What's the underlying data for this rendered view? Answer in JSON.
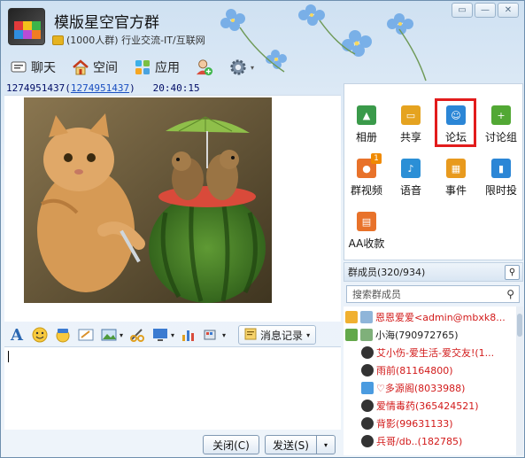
{
  "window": {
    "group_name": "模版星空官方群",
    "member_info": "(1000人群) 行业交流-IT/互联网",
    "controls": [
      "minimize",
      "maximize",
      "close"
    ]
  },
  "toolbar": {
    "items": [
      {
        "label": "聊天",
        "icon": "chat-icon"
      },
      {
        "label": "空间",
        "icon": "home-icon"
      },
      {
        "label": "应用",
        "icon": "apps-icon"
      },
      {
        "label": "",
        "icon": "add-contact-icon"
      },
      {
        "label": "",
        "icon": "gear-icon"
      }
    ]
  },
  "message": {
    "sender": "1274951437",
    "sender_link": "1274951437",
    "time": "20:40:15"
  },
  "format_bar": {
    "icons": [
      "font-icon",
      "emoji-icon",
      "magic-emoji-icon",
      "scribble-icon",
      "image-icon",
      "screenshot-icon",
      "screen-share-icon",
      "chart-icon",
      "shake-icon"
    ],
    "history_label": "消息记录"
  },
  "buttons": {
    "close": "关闭(C)",
    "send": "发送(S)"
  },
  "apps": [
    {
      "label": "相册",
      "icon": "album-icon",
      "color": "#3a9a4a"
    },
    {
      "label": "共享",
      "icon": "folder-icon",
      "color": "#e5a320"
    },
    {
      "label": "论坛",
      "icon": "forum-icon",
      "color": "#2b86d6"
    },
    {
      "label": "讨论组",
      "icon": "discussion-icon",
      "color": "#52a834"
    },
    {
      "label": "群视频",
      "icon": "video-icon",
      "color": "#e8722a",
      "badge": "1"
    },
    {
      "label": "语音",
      "icon": "voice-icon",
      "color": "#2b8fd6"
    },
    {
      "label": "事件",
      "icon": "event-icon",
      "color": "#e89a1e"
    },
    {
      "label": "限时投",
      "icon": "vote-icon",
      "color": "#2b86d6"
    },
    {
      "label": "AA收款",
      "icon": "aa-pay-icon",
      "color": "#e8722a"
    }
  ],
  "members": {
    "header": "群成员(320/934)",
    "search_placeholder": "搜索群成员",
    "list": [
      {
        "name": "恩恩爱爱<admin@mbxk8...",
        "color": "#d21a1a"
      },
      {
        "name": "小海(790972765)",
        "color": "#222222"
      },
      {
        "name": "艾小伤-爱生活-爱交友!(1...",
        "color": "#d21a1a"
      },
      {
        "name": "雨前(81164800)",
        "color": "#d21a1a"
      },
      {
        "name": "♡多源阁(8033988)",
        "color": "#d21a1a"
      },
      {
        "name": "爱情毒药(365424521)",
        "color": "#d21a1a"
      },
      {
        "name": "背影(99631133)",
        "color": "#d21a1a"
      },
      {
        "name": "兵哥/db..(182785)",
        "color": "#d21a1a"
      }
    ]
  }
}
